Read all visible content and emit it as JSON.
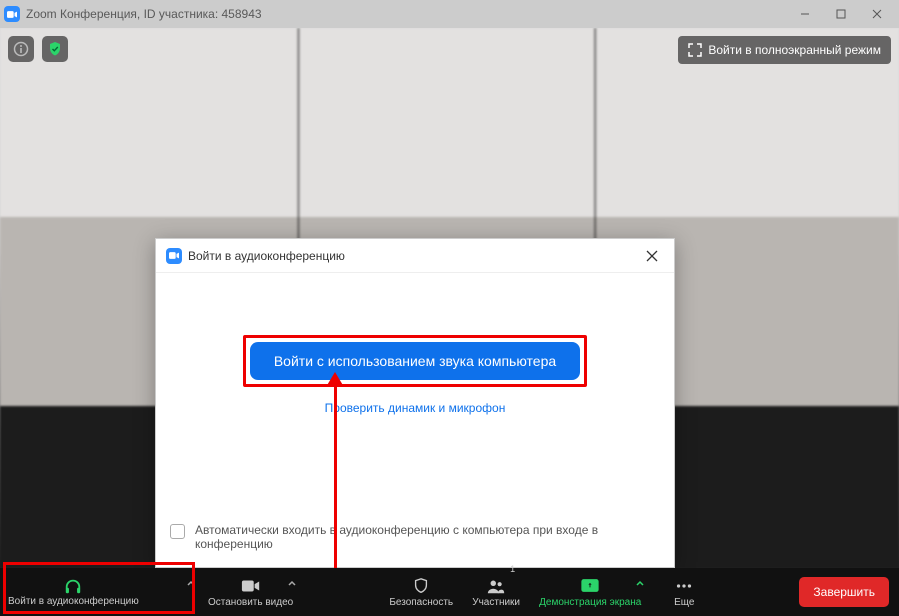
{
  "titlebar": {
    "title": "Zoom Конференция, ID участника: 458943"
  },
  "overlay": {
    "fullscreen_label": "Войти в полноэкранный режим"
  },
  "modal": {
    "title": "Войти в аудиоконференцию",
    "join_audio_btn": "Войти с использованием звука компьютера",
    "test_link": "Проверить динамик и микрофон",
    "auto_join_label": "Автоматически входить в аудиоконференцию с компьютера при входе в конференцию"
  },
  "toolbar": {
    "audio": "Войти в аудиоконференцию",
    "video": "Остановить видео",
    "security": "Безопасность",
    "participants": "Участники",
    "participants_count": "1",
    "share": "Демонстрация экрана",
    "more": "Еще",
    "end": "Завершить"
  }
}
